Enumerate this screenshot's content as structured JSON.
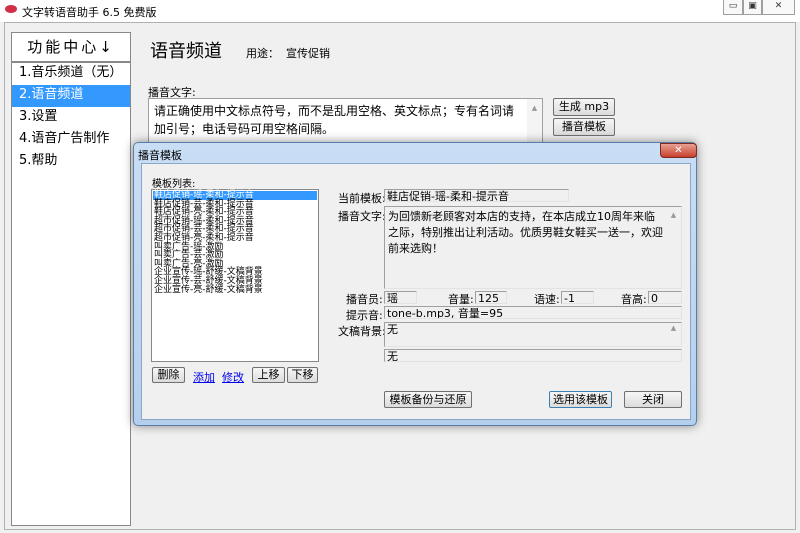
{
  "app": {
    "title": "文字转语音助手 6.5 免费版",
    "controls": {
      "minimize": "▭",
      "maximize": "▣",
      "close": "✕"
    }
  },
  "sidebar": {
    "header": "功能中心",
    "header_arrow": "↓",
    "items": [
      {
        "label": "1.音乐频道（无）"
      },
      {
        "label": "2.语音频道"
      },
      {
        "label": "3.设置"
      },
      {
        "label": "4.语音广告制作"
      },
      {
        "label": "5.帮助"
      }
    ],
    "selected_index": 1
  },
  "main": {
    "title": "语音频道",
    "purpose_label": "用途：",
    "purpose_value": "宣传促销",
    "text_label": "播音文字:",
    "text_value": "请正确使用中文标点符号，而不是乱用空格、英文标点；专有名词请加引号；电话号码可用空格间隔。",
    "buttons": {
      "generate": "生成 mp3",
      "template": "播音模板"
    }
  },
  "dialog": {
    "title": "播音模板",
    "close": "✕",
    "list_label": "模板列表:",
    "templates": [
      "鞋店促销-瑶-柔和-提示音",
      "鞋店促销-芸-柔和-提示音",
      "鞋店促销-亮-柔和-提示音",
      "超市促销-瑶-柔和-提示音",
      "超市促销-芸-柔和-提示音",
      "超市促销-亮-柔和-提示音",
      "叫卖广告-瑶-激励",
      "叫卖广告-芸-激励",
      "叫卖广告-亮-激励",
      "企业宣传-瑶-舒缓-文稿背景",
      "企业宣传-芸-舒缓-文稿背景",
      "企业宣传-亮-舒缓-文稿背景"
    ],
    "selected_index": 0,
    "list_buttons": {
      "delete": "删除",
      "add": "添加",
      "edit": "修改",
      "up": "上移",
      "down": "下移"
    },
    "fields": {
      "current_label": "当前模板:",
      "current_value": "鞋店促销-瑶-柔和-提示音",
      "text_label": "播音文字:",
      "text_value": "为回馈新老顾客对本店的支持，在本店成立10周年来临之际，特别推出让利活动。优质男鞋女鞋买一送一，欢迎前来选购！",
      "speaker_label": "播音员:",
      "speaker_value": "瑶",
      "volume_label": "音量:",
      "volume_value": "125",
      "speed_label": "语速:",
      "speed_value": "-1",
      "pitch_label": "音高:",
      "pitch_value": "0",
      "tone_label": "提示音:",
      "tone_value": "tone-b.mp3, 音量=95",
      "bg_label": "文稿背景:",
      "bg_value": "无",
      "bg_value2": "无"
    },
    "buttons": {
      "backup": "模板备份与还原",
      "use": "选用该模板",
      "close": "关闭"
    }
  }
}
